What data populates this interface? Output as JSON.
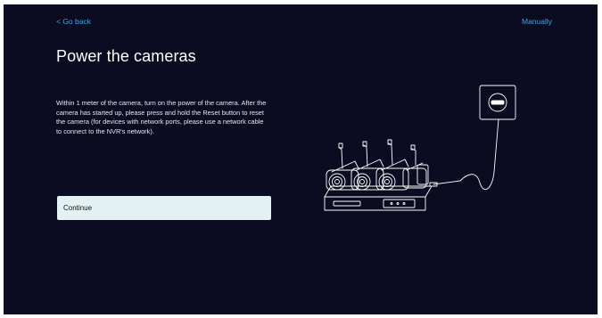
{
  "nav": {
    "back_label": "< Go back",
    "manual_label": "Manually"
  },
  "page": {
    "title": "Power the cameras",
    "description": "Within 1 meter of the camera, turn on the power of the camera. After the camera has started up, please press and hold the Reset button to reset the camera (for devices with network ports, please use a network cable to connect to the NVR's network)."
  },
  "actions": {
    "continue_label": "Continue"
  },
  "illustration": {
    "icon": "cameras-nvr-power-outlet-illustration"
  },
  "colors": {
    "background": "#0b0b22",
    "link": "#3fa9e6",
    "button": "#e4f1f3"
  }
}
